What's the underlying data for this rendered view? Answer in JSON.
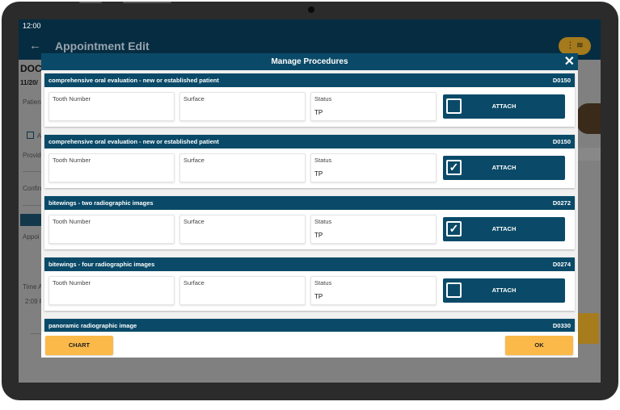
{
  "status_bar": {
    "time": "12:00"
  },
  "app_bar": {
    "back_icon": "arrow-left-icon",
    "title": "Appointment Edit",
    "menu_label": "⋮ ≋"
  },
  "background": {
    "doc_label": "DOC",
    "date_label": "11/20/",
    "patient_label": "Patien",
    "checkbox_label": "A",
    "provider_label": "Provid",
    "confirm_label": "Confirm",
    "appointment_label": "Appoi",
    "time_label": "Time A",
    "time_value": "2:09 P"
  },
  "modal": {
    "title": "Manage Procedures",
    "close_icon": "close-icon",
    "field_labels": {
      "tooth": "Tooth Number",
      "surface": "Surface",
      "status": "Status"
    },
    "attach_label": "ATTACH",
    "procedures": [
      {
        "name": "comprehensive oral evaluation - new or established patient",
        "code": "D0150",
        "tooth": "",
        "surface": "",
        "status": "TP",
        "attached": false,
        "mark": ""
      },
      {
        "name": "comprehensive oral evaluation - new or established patient",
        "code": "D0150",
        "tooth": "",
        "surface": "",
        "status": "TP",
        "attached": true,
        "mark": "✓"
      },
      {
        "name": "bitewings - two radiographic images",
        "code": "D0272",
        "tooth": "",
        "surface": "",
        "status": "TP",
        "attached": true,
        "mark": "✓"
      },
      {
        "name": "bitewings - four radiographic images",
        "code": "D0274",
        "tooth": "",
        "surface": "",
        "status": "TP",
        "attached": false,
        "mark": ""
      },
      {
        "name": "panoramic radiographic image",
        "code": "D0330",
        "tooth": "",
        "surface": "",
        "status": "",
        "attached": false,
        "mark": ""
      }
    ],
    "chart_button": "CHART",
    "ok_button": "OK"
  },
  "colors": {
    "header": "#0a4a68",
    "accent": "#fbb949",
    "app_bar": "#062c41"
  }
}
